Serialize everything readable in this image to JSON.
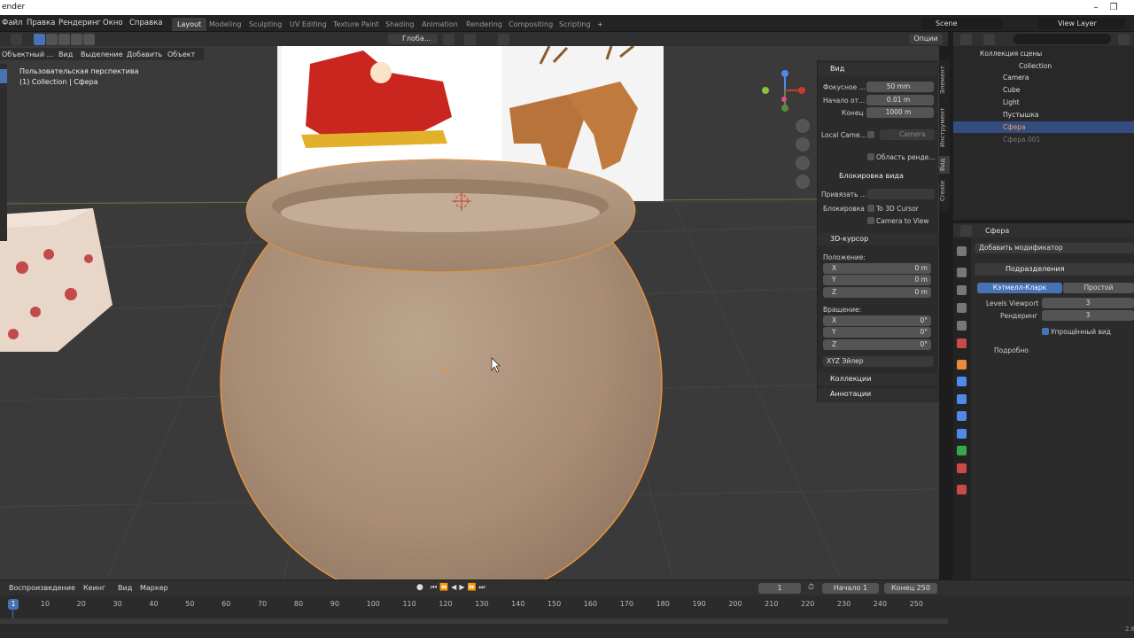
{
  "window": {
    "title": "ender"
  },
  "menus": {
    "file": "Файл",
    "edit": "Правка",
    "render": "Рендеринг",
    "window": "Окно",
    "help": "Справка"
  },
  "workspaces": [
    "Layout",
    "Modeling",
    "Sculpting",
    "UV Editing",
    "Texture Paint",
    "Shading",
    "Animation",
    "Rendering",
    "Compositing",
    "Scripting"
  ],
  "workspace_add": "+",
  "scene": {
    "name": "Scene",
    "view_layer": "View Layer"
  },
  "viewport_header": {
    "mode": "Объектный ...",
    "view": "Вид",
    "select": "Выделение",
    "add": "Добавить",
    "object": "Объект",
    "transform": "Глоба...",
    "options": "Опции"
  },
  "viewport_info": {
    "line1": "Пользовательская перспектива",
    "line2": "(1) Collection | Сфера"
  },
  "npanel": {
    "view_header": "Вид",
    "focal_label": "Фокусное ...",
    "focal_value": "50 mm",
    "clip_start_label": "Начало от...",
    "clip_start_value": "0.01 m",
    "clip_end_label": "Конец",
    "clip_end_value": "1000 m",
    "local_camera_label": "Local Came...",
    "local_camera_value": "Camera",
    "render_region": "Область ренде...",
    "view_lock_header": "Блокировка вида",
    "lock_to_label": "Привязать ...",
    "lock_label": "Блокировка",
    "to_3d_cursor": "To 3D Cursor",
    "camera_to_view": "Camera to View",
    "cursor_header": "3D-курсор",
    "location_label": "Положение:",
    "loc": [
      {
        "axis": "X",
        "value": "0 m"
      },
      {
        "axis": "Y",
        "value": "0 m"
      },
      {
        "axis": "Z",
        "value": "0 m"
      }
    ],
    "rotation_label": "Вращение:",
    "rot": [
      {
        "axis": "X",
        "value": "0°"
      },
      {
        "axis": "Y",
        "value": "0°"
      },
      {
        "axis": "Z",
        "value": "0°"
      }
    ],
    "rotation_mode": "XYZ Эйлер",
    "collections": "Коллекции",
    "annotations": "Аннотации"
  },
  "side_tabs": [
    "Элемент",
    "Инструмент",
    "Вид",
    "Create"
  ],
  "outliner": {
    "root": "Коллекция сцены",
    "items": [
      {
        "name": "Collection",
        "indent": 1
      },
      {
        "name": "Camera",
        "indent": 2
      },
      {
        "name": "Cube",
        "indent": 2
      },
      {
        "name": "Light",
        "indent": 2
      },
      {
        "name": "Пустышка",
        "indent": 2
      },
      {
        "name": "Сфера",
        "indent": 2,
        "selected": true
      },
      {
        "name": "Сфера.001",
        "indent": 2,
        "dim": true
      }
    ]
  },
  "properties": {
    "object_name": "Сфера",
    "add_modifier": "Добавить модификатор",
    "modifier_name": "Подразделения",
    "catmull": "Кэтмелл-Кларк",
    "simple": "Простой",
    "levels_viewport_label": "Levels Viewport",
    "levels_viewport": "3",
    "render_label": "Рендеринг",
    "render_value": "3",
    "optimal": "Упрощённый вид",
    "advanced": "Подробно"
  },
  "timeline": {
    "playback": "Воспроизведение",
    "keying": "Кеинг",
    "view": "Вид",
    "marker": "Маркер",
    "current_frame": "1",
    "start_label": "Начало",
    "start": "1",
    "end_label": "Конец",
    "end": "250",
    "ticks": [
      "1",
      "10",
      "20",
      "30",
      "40",
      "50",
      "60",
      "70",
      "80",
      "90",
      "100",
      "110",
      "120",
      "130",
      "140",
      "150",
      "160",
      "170",
      "180",
      "190",
      "200",
      "210",
      "220",
      "230",
      "240",
      "250"
    ]
  },
  "status": {
    "version": "2.8"
  },
  "colors": {
    "accent": "#4772b3",
    "selection": "#e8923a",
    "header": "#303030"
  }
}
